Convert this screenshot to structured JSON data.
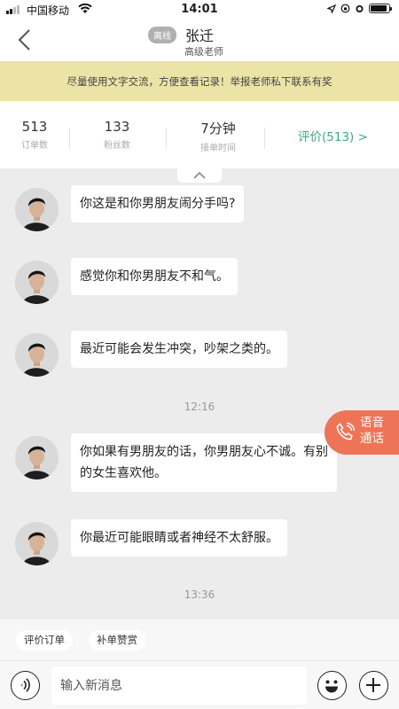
{
  "status_bar": {
    "carrier": "中国移动",
    "time": "14:01"
  },
  "header": {
    "status_badge": "离线",
    "name": "张迁",
    "title": "高级老师"
  },
  "notice": "尽量使用文字交流，方便查看记录！举报老师私下联系有奖",
  "stats": [
    {
      "value": "513",
      "label": "订单数"
    },
    {
      "value": "133",
      "label": "粉丝数"
    },
    {
      "value": "7分钟",
      "label": "接单时间"
    }
  ],
  "rating_link": "评价(513) >",
  "messages": [
    {
      "text": "你这是和你男朋友闹分手吗?"
    },
    {
      "text": "感觉你和你男朋友不和气。"
    },
    {
      "text": "最近可能会发生冲突，吵架之类的。"
    },
    {
      "text": "你如果有男朋友的话，你男朋友心不诚。有别的女生喜欢他。"
    },
    {
      "text": "你最近可能眼睛或者神经不太舒服。"
    }
  ],
  "times": [
    "12:16",
    "13:36"
  ],
  "voice_call": {
    "line1": "语音",
    "line2": "通话"
  },
  "quick_actions": [
    "评价订单",
    "补单赞赏"
  ],
  "input": {
    "placeholder": "输入新消息"
  },
  "colors": {
    "accent_green": "#3eaa7c",
    "voice_orange": "#ee7458",
    "notice_bg": "#ece4a6"
  },
  "icons": [
    "back-chevron-icon",
    "wifi-icon",
    "phone-icon",
    "voice-toggle-icon",
    "emoji-icon",
    "plus-icon"
  ]
}
